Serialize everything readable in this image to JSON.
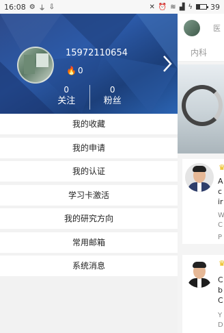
{
  "status_bar": {
    "time": "16:08",
    "battery_percent": "39",
    "battery_level": 0.39,
    "left_icons": [
      "settings-icon",
      "usb-icon",
      "download-icon"
    ],
    "right_icons": [
      "mute-icon",
      "alarm-icon",
      "wifi-icon",
      "signal-icon",
      "charging-icon"
    ]
  },
  "profile": {
    "phone": "15972110654",
    "fire_count": "0",
    "stats": [
      {
        "count": "0",
        "label": "关注"
      },
      {
        "count": "0",
        "label": "粉丝"
      }
    ]
  },
  "menu": [
    {
      "label": "我的收藏"
    },
    {
      "label": "我的申请"
    },
    {
      "label": "我的认证"
    },
    {
      "label": "学习卡激活"
    },
    {
      "label": "我的研究方向"
    },
    {
      "label": "常用邮箱"
    },
    {
      "label": "系统消息"
    }
  ],
  "background_content": {
    "topbar_text": "医",
    "tab_label": "内科",
    "cards": [
      {
        "lines": [
          "A",
          "c",
          "ir"
        ],
        "meta": [
          "W",
          "C",
          "P"
        ]
      },
      {
        "lines": [
          "C",
          "b",
          "C"
        ],
        "meta": [
          "Y",
          "D"
        ]
      }
    ]
  },
  "colors": {
    "header_blue": "#2c5aa8",
    "fire_red": "#ff5c3a",
    "medal_gold": "#e8b400"
  }
}
